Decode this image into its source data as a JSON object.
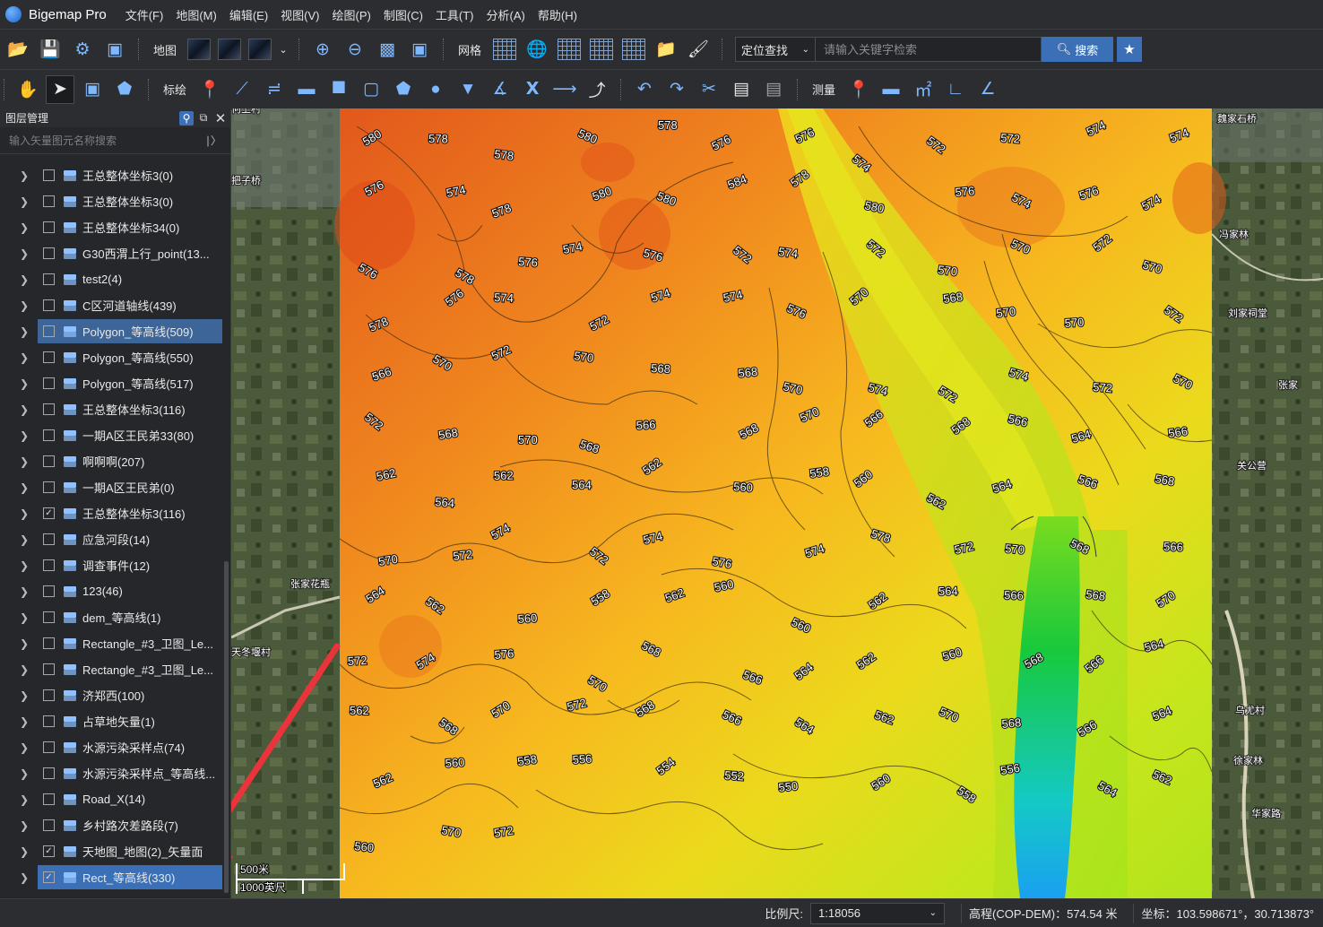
{
  "app": {
    "name": "Bigemap Pro"
  },
  "menu": [
    "文件(F)",
    "地图(M)",
    "编辑(E)",
    "视图(V)",
    "绘图(P)",
    "制图(C)",
    "工具(T)",
    "分析(A)",
    "帮助(H)"
  ],
  "toolbar1": {
    "map_label": "地图",
    "grid_label": "网格",
    "locate_select": "定位查找",
    "search_placeholder": "请输入关键字检索",
    "search_button": "搜索"
  },
  "toolbar2": {
    "plot_label": "标绘",
    "measure_label": "测量"
  },
  "layer_panel": {
    "title": "图层管理",
    "search_placeholder": "输入矢量图元名称搜索",
    "layers": [
      {
        "label": "王总整体坐标3(0)",
        "checked": false,
        "selected": false
      },
      {
        "label": "王总整体坐标3(0)",
        "checked": false,
        "selected": false
      },
      {
        "label": "王总整体坐标34(0)",
        "checked": false,
        "selected": false
      },
      {
        "label": "G30西渭上行_point(13...",
        "checked": false,
        "selected": false
      },
      {
        "label": "test2(4)",
        "checked": false,
        "selected": false
      },
      {
        "label": "C区河道轴线(439)",
        "checked": false,
        "selected": false
      },
      {
        "label": "Polygon_等高线(509)",
        "checked": false,
        "selected": true
      },
      {
        "label": "Polygon_等高线(550)",
        "checked": false,
        "selected": false
      },
      {
        "label": "Polygon_等高线(517)",
        "checked": false,
        "selected": false
      },
      {
        "label": "王总整体坐标3(116)",
        "checked": false,
        "selected": false
      },
      {
        "label": "一期A区王民弟33(80)",
        "checked": false,
        "selected": false
      },
      {
        "label": "啊啊啊(207)",
        "checked": false,
        "selected": false
      },
      {
        "label": "一期A区王民弟(0)",
        "checked": false,
        "selected": false
      },
      {
        "label": "王总整体坐标3(116)",
        "checked": true,
        "selected": false
      },
      {
        "label": "应急河段(14)",
        "checked": false,
        "selected": false
      },
      {
        "label": "调查事件(12)",
        "checked": false,
        "selected": false
      },
      {
        "label": "123(46)",
        "checked": false,
        "selected": false
      },
      {
        "label": "dem_等高线(1)",
        "checked": false,
        "selected": false
      },
      {
        "label": "Rectangle_#3_卫图_Le...",
        "checked": false,
        "selected": false
      },
      {
        "label": "Rectangle_#3_卫图_Le...",
        "checked": false,
        "selected": false
      },
      {
        "label": "济郑西(100)",
        "checked": false,
        "selected": false
      },
      {
        "label": "占草地矢量(1)",
        "checked": false,
        "selected": false
      },
      {
        "label": "水源污染采样点(74)",
        "checked": false,
        "selected": false
      },
      {
        "label": "水源污染采样点_等高线...",
        "checked": false,
        "selected": false
      },
      {
        "label": "Road_X(14)",
        "checked": false,
        "selected": false
      },
      {
        "label": "乡村路次差路段(7)",
        "checked": false,
        "selected": false
      },
      {
        "label": "天地图_地图(2)_矢量面",
        "checked": true,
        "selected": false
      },
      {
        "label": "Rect_等高线(330)",
        "checked": true,
        "selected": true
      }
    ]
  },
  "map": {
    "place_labels": [
      "魏家石桥",
      "冯家林",
      "刘家祠堂",
      "张家",
      "关公营",
      "乌尤村",
      "徐家林",
      "华家路",
      "张家花瓶",
      "天冬堰村",
      "把子桥",
      "何上村"
    ],
    "contour_labels": [
      "580",
      "578",
      "578",
      "580",
      "578",
      "576",
      "576",
      "574",
      "572",
      "572",
      "574",
      "574",
      "576",
      "574",
      "578",
      "580",
      "580",
      "584",
      "578",
      "580",
      "576",
      "574",
      "576",
      "574",
      "576",
      "578",
      "576",
      "574",
      "576",
      "572",
      "574",
      "572",
      "570",
      "570",
      "572",
      "570",
      "578",
      "576",
      "574",
      "572",
      "574",
      "574",
      "576",
      "570",
      "568",
      "570",
      "570",
      "572",
      "566",
      "570",
      "572",
      "570",
      "568",
      "568",
      "570",
      "574",
      "572",
      "574",
      "572",
      "570",
      "572",
      "568",
      "570",
      "568",
      "566",
      "568",
      "570",
      "566",
      "568",
      "566",
      "564",
      "566",
      "562",
      "564",
      "562",
      "564",
      "562",
      "560",
      "558",
      "560",
      "562",
      "564",
      "566",
      "568",
      "570",
      "572",
      "574",
      "572",
      "574",
      "576",
      "574",
      "578",
      "572",
      "570",
      "568",
      "566",
      "564",
      "562",
      "560",
      "558",
      "562",
      "560",
      "560",
      "562",
      "564",
      "566",
      "568",
      "570",
      "572",
      "574",
      "576",
      "570",
      "568",
      "566",
      "564",
      "562",
      "560",
      "568",
      "566",
      "564",
      "562",
      "568",
      "570",
      "572",
      "568",
      "566",
      "564",
      "562",
      "570",
      "568",
      "566",
      "564",
      "562",
      "560",
      "558",
      "556",
      "554",
      "552",
      "550",
      "560",
      "558",
      "556",
      "564",
      "562",
      "560",
      "570",
      "572"
    ],
    "scale_bar": {
      "top": "500米",
      "bottom": "1000英尺"
    }
  },
  "status": {
    "scale_label": "比例尺:",
    "scale_value": "1:18056",
    "elevation": "高程(COP-DEM)：574.54 米",
    "coords": "坐标：103.598671°，30.713873°"
  }
}
